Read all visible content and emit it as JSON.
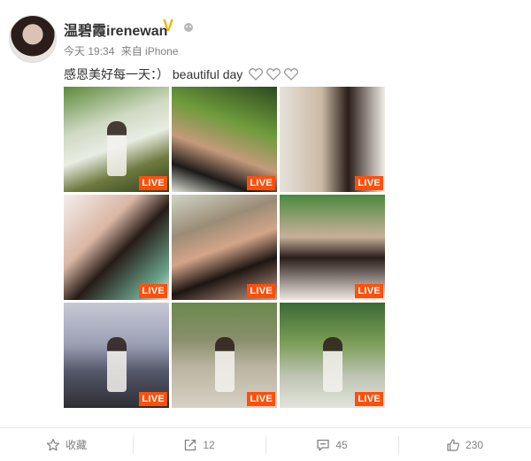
{
  "post": {
    "username": "温碧霞irenewan",
    "verified_mark": "V",
    "time": "今天 19:34",
    "source": "来自 iPhone",
    "text": "感恩美好每一天：）  beautiful day"
  },
  "photos": [
    {
      "badge": "LIVE"
    },
    {
      "badge": "LIVE"
    },
    {
      "badge": "LIVE"
    },
    {
      "badge": "LIVE"
    },
    {
      "badge": "LIVE"
    },
    {
      "badge": "LIVE"
    },
    {
      "badge": "LIVE"
    },
    {
      "badge": "LIVE"
    },
    {
      "badge": "LIVE"
    }
  ],
  "actions": {
    "favorite_label": "收藏",
    "repost_count": "12",
    "comment_count": "45",
    "like_count": "230"
  },
  "colors": {
    "live_badge": "#ff4f0b",
    "verified": "#f5b400",
    "meta_text": "#808080"
  },
  "icons": [
    "star-icon",
    "repost-icon",
    "comment-icon",
    "thumbs-up-icon",
    "heart-emoticon-icon",
    "rank-badge-icon"
  ]
}
